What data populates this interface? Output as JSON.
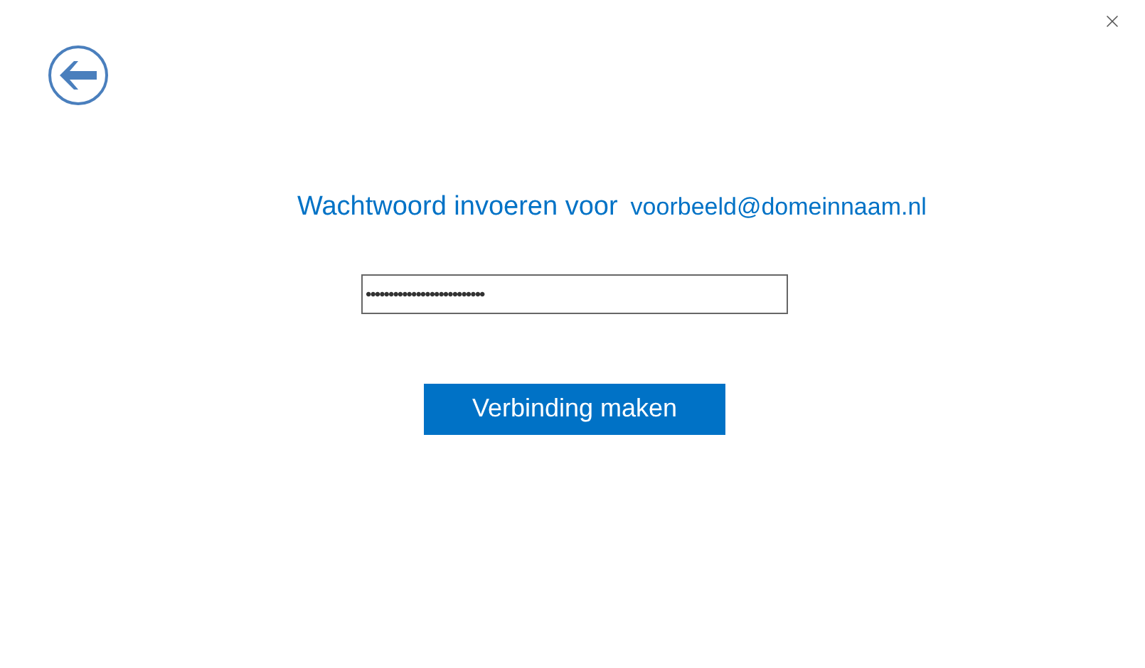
{
  "heading": {
    "prompt": "Wachtwoord invoeren voor",
    "account": "voorbeeld@domeinnaam.nl"
  },
  "password_field": {
    "value": "••••••••••••••••••••••••••"
  },
  "buttons": [
    "Verbinding maken"
  ]
}
